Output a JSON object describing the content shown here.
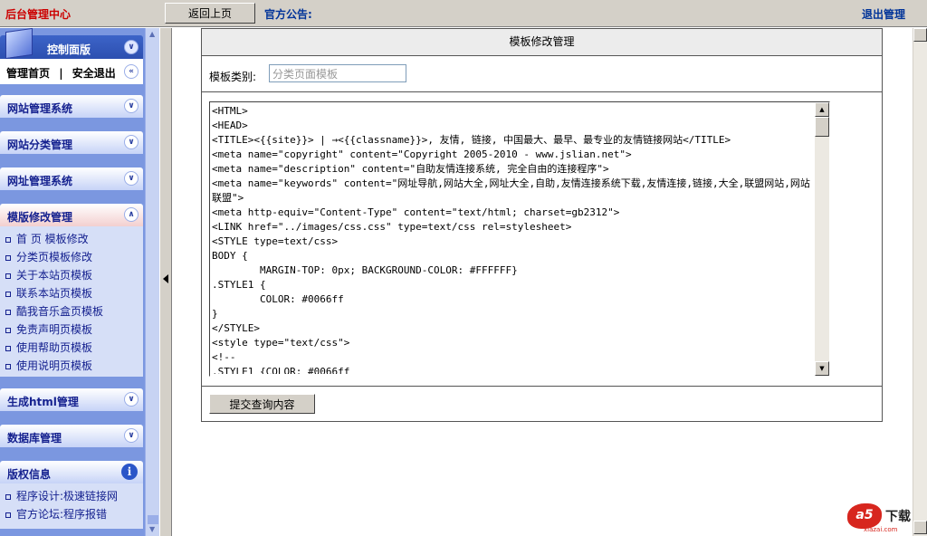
{
  "topbar": {
    "title": "后台管理中心",
    "back_label": "返回上页",
    "notice_label": "官方公告:",
    "logout_label": "退出管理"
  },
  "sidebar": {
    "control_panel": {
      "title": "控制面版",
      "home_link": "管理首页",
      "separator": "|",
      "logout_link": "安全退出"
    },
    "sections": [
      {
        "label": "网站管理系统"
      },
      {
        "label": "网站分类管理"
      },
      {
        "label": "网址管理系统"
      }
    ],
    "template_section": {
      "label": "模版修改管理",
      "items": [
        "首 页 模板修改",
        "分类页模板修改",
        "关于本站页模板",
        "联系本站页模板",
        "酷我音乐盒页模板",
        "免责声明页模板",
        "使用帮助页模板",
        "使用说明页模板"
      ]
    },
    "lower_sections": [
      {
        "label": "生成html管理"
      },
      {
        "label": "数据库管理"
      }
    ],
    "copyright": {
      "label": "版权信息",
      "items": [
        "程序设计:极速链接网",
        "官方论坛:程序报错"
      ]
    }
  },
  "main": {
    "header": "模板修改管理",
    "category_label": "模板类别:",
    "category_value": "分类页面模板",
    "editor_content": "<HTML>\n<HEAD>\n<TITLE><{{site}}> | →<{{classname}}>, 友情, 链接, 中国最大、最早、最专业的友情链接网站</TITLE>\n<meta name=\"copyright\" content=\"Copyright 2005-2010 - www.jslian.net\">\n<meta name=\"description\" content=\"自助友情连接系统, 完全自由的连接程序\">\n<meta name=\"keywords\" content=\"网址导航,网站大全,网址大全,自助,友情连接系统下载,友情连接,链接,大全,联盟网站,网站联盟\">\n<meta http-equiv=\"Content-Type\" content=\"text/html; charset=gb2312\">\n<LINK href=\"../images/css.css\" type=text/css rel=stylesheet>\n<STYLE type=text/css>\nBODY {\n        MARGIN-TOP: 0px; BACKGROUND-COLOR: #FFFFFF}\n.STYLE1 {\n        COLOR: #0066ff\n}\n</STYLE>\n<style type=\"text/css\">\n<!--\n.STYLE1 {COLOR: #0066ff",
    "submit_label": "提交查询内容"
  },
  "watermark": {
    "logo_text": "a5",
    "cn_text": "下载",
    "domain": "xiazai.com"
  }
}
